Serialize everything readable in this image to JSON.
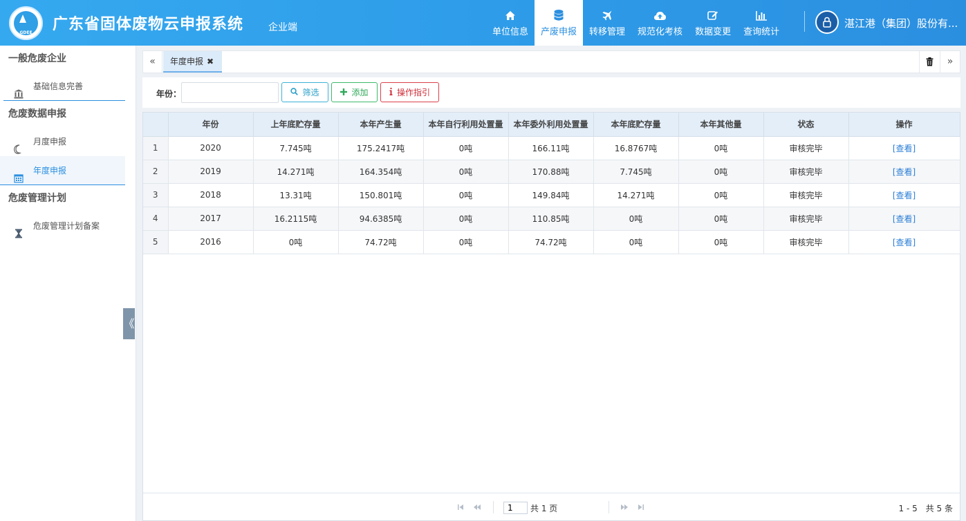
{
  "header": {
    "logo_text": "GDEE",
    "title": "广东省固体废物云申报系统",
    "subtitle": "企业端",
    "nav": [
      {
        "label": "单位信息",
        "icon": "home-icon"
      },
      {
        "label": "产废申报",
        "icon": "database-icon",
        "active": true
      },
      {
        "label": "转移管理",
        "icon": "plane-icon"
      },
      {
        "label": "规范化考核",
        "icon": "cloud-upload-icon"
      },
      {
        "label": "数据变更",
        "icon": "edit-icon"
      },
      {
        "label": "查询统计",
        "icon": "bar-chart-icon"
      }
    ],
    "user": "湛江港（集团）股份有..."
  },
  "sidebar": {
    "groups": [
      {
        "title": "一般危废企业",
        "items": [
          {
            "label": "基础信息完善",
            "icon": "bank-icon"
          }
        ]
      },
      {
        "title": "危废数据申报",
        "items": [
          {
            "label": "月度申报",
            "icon": "moon-icon"
          },
          {
            "label": "年度申报",
            "icon": "calendar-icon",
            "active": true
          }
        ]
      },
      {
        "title": "危废管理计划",
        "items": [
          {
            "label": "危废管理计划备案",
            "icon": "hourglass-icon"
          }
        ]
      }
    ],
    "collapse": "《"
  },
  "tabs": {
    "prev": "«",
    "next": "»",
    "items": [
      {
        "label": "年度申报",
        "close": "✖"
      }
    ]
  },
  "toolbar": {
    "year_label": "年份：",
    "year_value": "",
    "filter_label": "筛选",
    "add_label": "添加",
    "guide_label": "操作指引"
  },
  "table": {
    "columns": [
      "",
      "年份",
      "上年底贮存量",
      "本年产生量",
      "本年自行利用处置量",
      "本年委外利用处置量",
      "本年底贮存量",
      "本年其他量",
      "状态",
      "操作"
    ],
    "rows": [
      [
        "1",
        "2020",
        "7.745吨",
        "175.2417吨",
        "0吨",
        "166.11吨",
        "16.8767吨",
        "0吨",
        "审核完毕",
        "[查看]"
      ],
      [
        "2",
        "2019",
        "14.271吨",
        "164.354吨",
        "0吨",
        "170.88吨",
        "7.745吨",
        "0吨",
        "审核完毕",
        "[查看]"
      ],
      [
        "3",
        "2018",
        "13.31吨",
        "150.801吨",
        "0吨",
        "149.84吨",
        "14.271吨",
        "0吨",
        "审核完毕",
        "[查看]"
      ],
      [
        "4",
        "2017",
        "16.2115吨",
        "94.6385吨",
        "0吨",
        "110.85吨",
        "0吨",
        "0吨",
        "审核完毕",
        "[查看]"
      ],
      [
        "5",
        "2016",
        "0吨",
        "74.72吨",
        "0吨",
        "74.72吨",
        "0吨",
        "0吨",
        "审核完毕",
        "[查看]"
      ]
    ]
  },
  "pager": {
    "page": "1",
    "total_pages": "共 1 页",
    "range": "1 - 5　共 5 条"
  }
}
